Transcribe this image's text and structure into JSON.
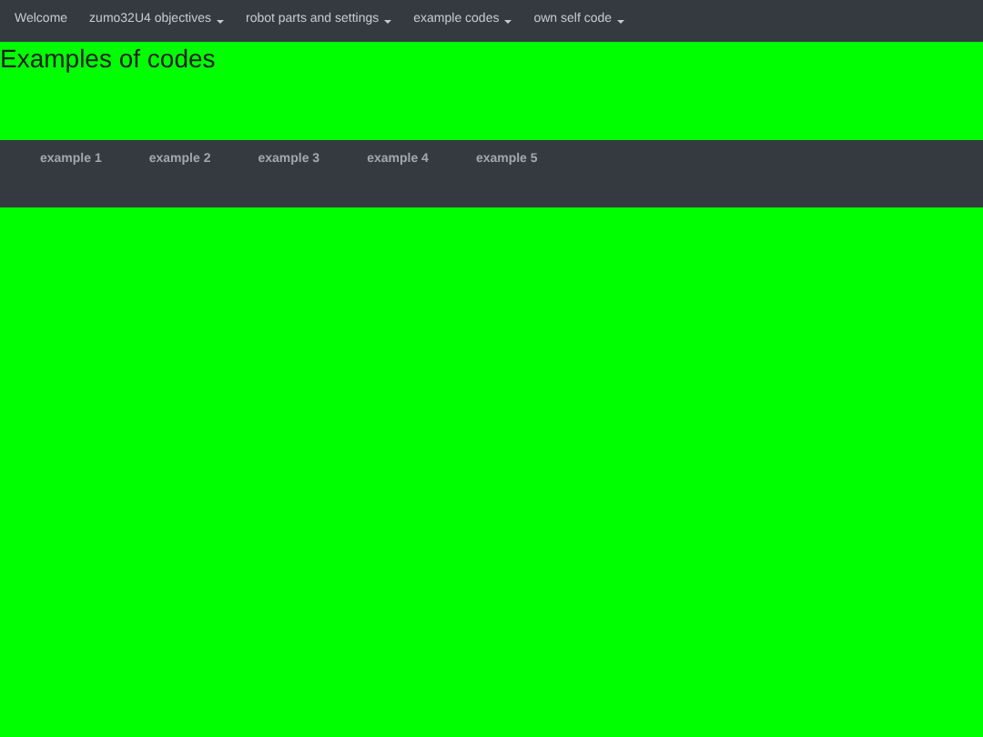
{
  "navbar": {
    "items": [
      {
        "label": "Welcome",
        "dropdown": false
      },
      {
        "label": "zumo32U4 objectives",
        "dropdown": true
      },
      {
        "label": "robot parts and settings",
        "dropdown": true
      },
      {
        "label": "example codes",
        "dropdown": true
      },
      {
        "label": "own self code",
        "dropdown": true
      }
    ]
  },
  "heading": "Examples of codes",
  "tabs": [
    "example 1",
    "example 2",
    "example 3",
    "example 4",
    "example 5"
  ]
}
